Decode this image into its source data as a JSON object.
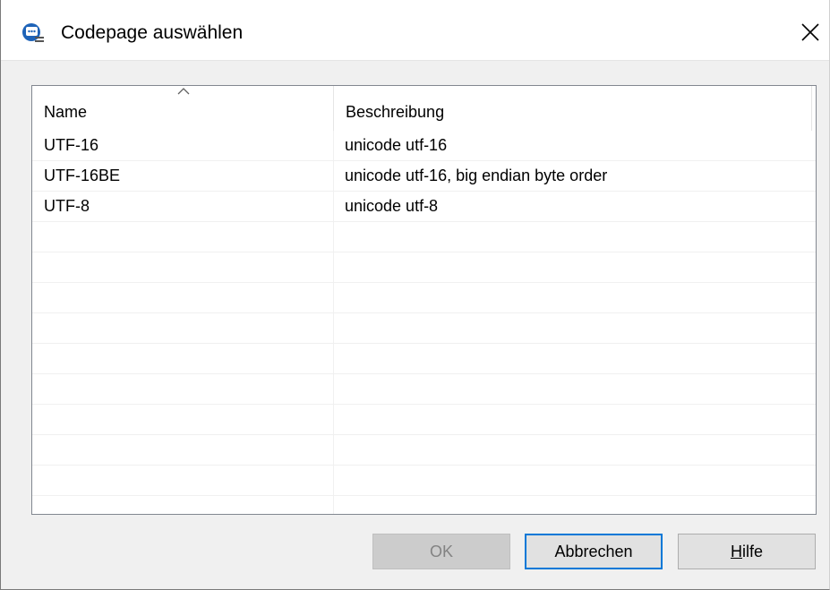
{
  "dialog": {
    "title": "Codepage auswählen",
    "icon": "chat-bubble-app-icon",
    "close_icon": "close-icon"
  },
  "list": {
    "columns": [
      {
        "label": "Name",
        "sorted": "ascending"
      },
      {
        "label": "Beschreibung"
      }
    ],
    "rows": [
      {
        "name": "UTF-16",
        "description": "unicode utf-16"
      },
      {
        "name": "UTF-16BE",
        "description": "unicode utf-16, big endian byte order"
      },
      {
        "name": "UTF-8",
        "description": "unicode utf-8"
      }
    ],
    "empty_row_count": 10
  },
  "buttons": {
    "ok": {
      "label": "OK",
      "enabled": false
    },
    "cancel": {
      "label": "Abbrechen",
      "focused": true
    },
    "help": {
      "label_accel": "H",
      "label_rest": "ilfe"
    }
  },
  "colors": {
    "focus_border": "#0078d7",
    "disabled_text": "#838383"
  }
}
